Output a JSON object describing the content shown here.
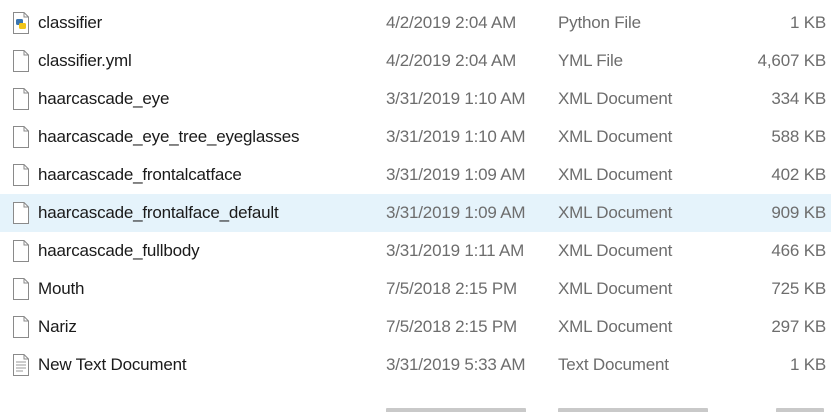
{
  "files": [
    {
      "name": "classifier",
      "date": "4/2/2019 2:04 AM",
      "type": "Python File",
      "size": "1 KB",
      "icon": "python-file-icon"
    },
    {
      "name": "classifier.yml",
      "date": "4/2/2019 2:04 AM",
      "type": "YML File",
      "size": "4,607 KB",
      "icon": "file-icon"
    },
    {
      "name": "haarcascade_eye",
      "date": "3/31/2019 1:10 AM",
      "type": "XML Document",
      "size": "334 KB",
      "icon": "file-icon"
    },
    {
      "name": "haarcascade_eye_tree_eyeglasses",
      "date": "3/31/2019 1:10 AM",
      "type": "XML Document",
      "size": "588 KB",
      "icon": "file-icon"
    },
    {
      "name": "haarcascade_frontalcatface",
      "date": "3/31/2019 1:09 AM",
      "type": "XML Document",
      "size": "402 KB",
      "icon": "file-icon"
    },
    {
      "name": "haarcascade_frontalface_default",
      "date": "3/31/2019 1:09 AM",
      "type": "XML Document",
      "size": "909 KB",
      "icon": "file-icon",
      "selected": true
    },
    {
      "name": "haarcascade_fullbody",
      "date": "3/31/2019 1:11 AM",
      "type": "XML Document",
      "size": "466 KB",
      "icon": "file-icon"
    },
    {
      "name": "Mouth",
      "date": "7/5/2018 2:15 PM",
      "type": "XML Document",
      "size": "725 KB",
      "icon": "file-icon"
    },
    {
      "name": "Nariz",
      "date": "7/5/2018 2:15 PM",
      "type": "XML Document",
      "size": "297 KB",
      "icon": "file-icon"
    },
    {
      "name": "New Text Document",
      "date": "3/31/2019 5:33 AM",
      "type": "Text Document",
      "size": "1 KB",
      "icon": "text-document-icon"
    }
  ],
  "colors": {
    "selected_row": "#e5f3fb",
    "secondary_text": "#6d6d6d",
    "python_blue": "#3a75b0",
    "python_yellow": "#f0c419"
  }
}
